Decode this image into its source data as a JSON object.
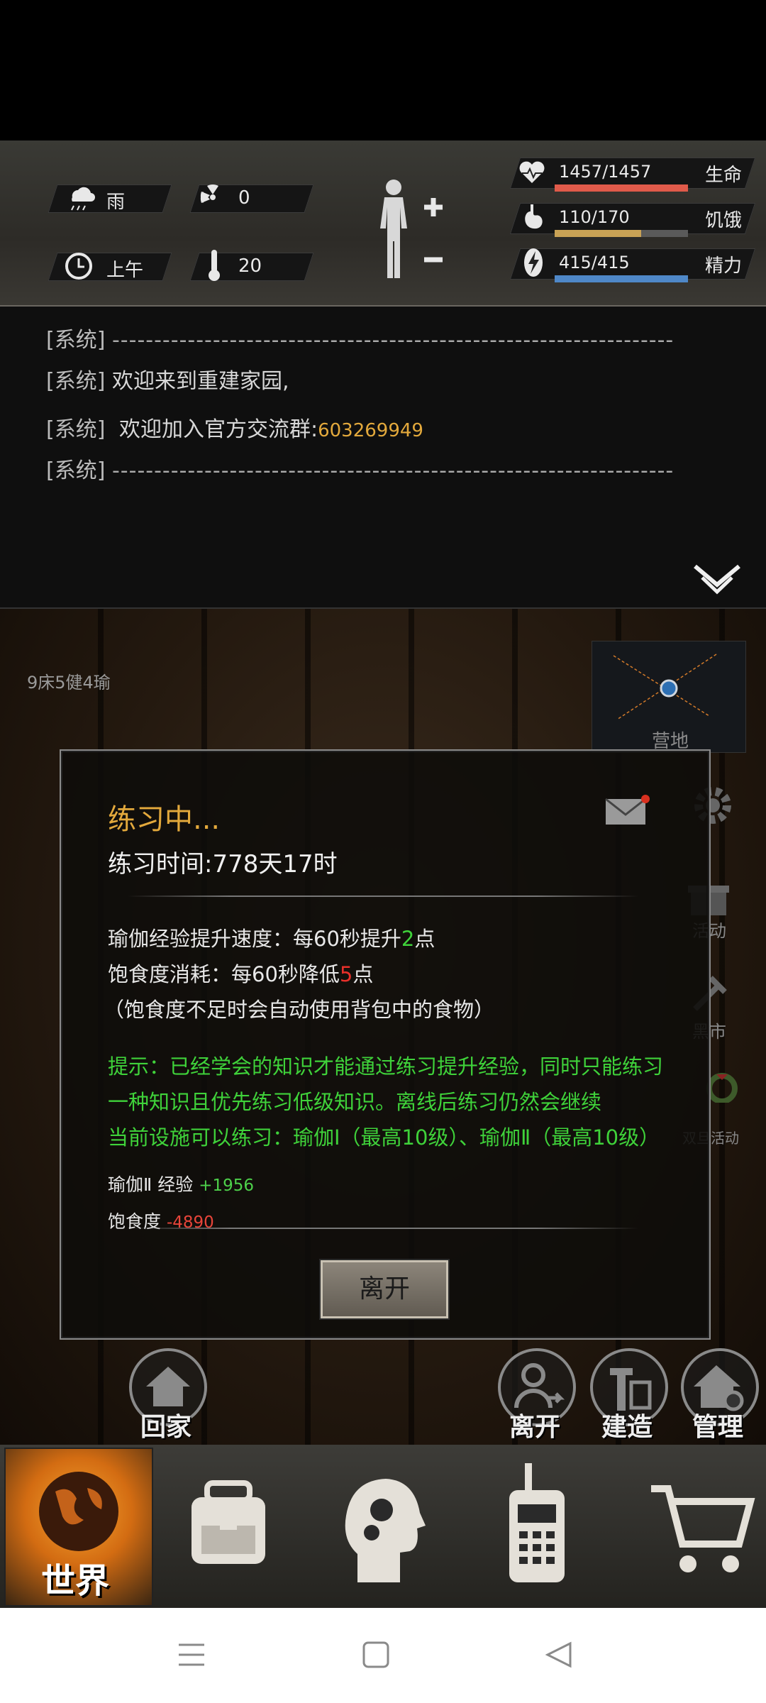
{
  "status": {
    "weather": "雨",
    "radiation": "0",
    "time_of_day": "上午",
    "temperature": "20",
    "life": {
      "value": "1457/1457",
      "label": "生命",
      "fill": 1.0,
      "color": "#e05a4a"
    },
    "hunger": {
      "value": "110/170",
      "label": "饥饿",
      "fill": 0.647,
      "color": "#c9a255"
    },
    "energy": {
      "value": "415/415",
      "label": "精力",
      "fill": 1.0,
      "color": "#4f88c8"
    }
  },
  "log": {
    "tag": "[系统]",
    "dash_line": "-------------------------------------------------------------------",
    "welcome": "欢迎来到重建家园,",
    "group_prefix": "欢迎加入官方交流群:",
    "group_number": "603269949"
  },
  "scene": {
    "info": "9床5健4瑜",
    "minimap_label": "营地",
    "side": {
      "activity": "活动",
      "black_market": "黑市",
      "double_event": "双旦活动"
    },
    "round": {
      "home": "回家",
      "leave": "离开",
      "build": "建造",
      "manage": "管理"
    }
  },
  "dialog": {
    "title": "练习中...",
    "time": "练习时间:778天17时",
    "line1_prefix": "瑜伽经验提升速度：每60秒提升",
    "line1_value": "2",
    "line1_suffix": "点",
    "line2_prefix": "饱食度消耗：每60秒降低",
    "line2_value": "5",
    "line2_suffix": "点",
    "line3": "（饱食度不足时会自动使用背包中的食物）",
    "hint1": "提示：已经学会的知识才能通过练习提升经验，同时只能练习",
    "hint2": "一种知识且优先练习低级知识。离线后练习仍然会继续",
    "hint3": "当前设施可以练习：瑜伽Ⅰ（最高10级）、瑜伽Ⅱ（最高10级）",
    "exp_label": "瑜伽Ⅱ 经验",
    "exp_value": "+1956",
    "food_label": "饱食度",
    "food_value": "-4890",
    "leave_button": "离开"
  },
  "nav": {
    "world": "世界"
  },
  "colors": {
    "green": "#3fd23a",
    "orange": "#e3a93c",
    "red": "#e8302a",
    "value_green": "#4dd04a",
    "value_red": "#e8453a"
  }
}
